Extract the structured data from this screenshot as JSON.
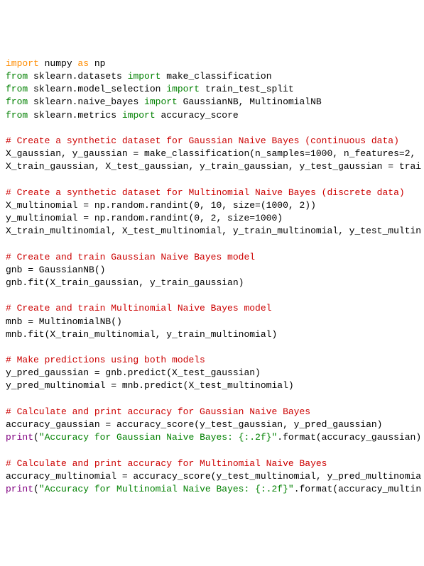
{
  "lines": [
    {
      "type": "code",
      "tokens": [
        {
          "cls": "kw-orange",
          "text": "import"
        },
        {
          "cls": "ident",
          "text": " numpy "
        },
        {
          "cls": "kw-orange",
          "text": "as"
        },
        {
          "cls": "ident",
          "text": " np"
        }
      ]
    },
    {
      "type": "code",
      "tokens": [
        {
          "cls": "kw-from",
          "text": "from"
        },
        {
          "cls": "ident",
          "text": " sklearn.datasets "
        },
        {
          "cls": "kw-from",
          "text": "import"
        },
        {
          "cls": "ident",
          "text": " make_classification"
        }
      ]
    },
    {
      "type": "code",
      "tokens": [
        {
          "cls": "kw-from",
          "text": "from"
        },
        {
          "cls": "ident",
          "text": " sklearn.model_selection "
        },
        {
          "cls": "kw-from",
          "text": "import"
        },
        {
          "cls": "ident",
          "text": " train_test_split"
        }
      ]
    },
    {
      "type": "code",
      "tokens": [
        {
          "cls": "kw-from",
          "text": "from"
        },
        {
          "cls": "ident",
          "text": " sklearn.naive_bayes "
        },
        {
          "cls": "kw-from",
          "text": "import"
        },
        {
          "cls": "ident",
          "text": " GaussianNB, MultinomialNB"
        }
      ]
    },
    {
      "type": "code",
      "tokens": [
        {
          "cls": "kw-from",
          "text": "from"
        },
        {
          "cls": "ident",
          "text": " sklearn.metrics "
        },
        {
          "cls": "kw-from",
          "text": "import"
        },
        {
          "cls": "ident",
          "text": " accuracy_score"
        }
      ]
    },
    {
      "type": "blank"
    },
    {
      "type": "comment",
      "text": "# Create a synthetic dataset for Gaussian Naive Bayes (continuous data)"
    },
    {
      "type": "code",
      "tokens": [
        {
          "cls": "ident",
          "text": "X_gaussian, y_gaussian = make_classification(n_samples=1000, n_features=2,"
        }
      ]
    },
    {
      "type": "code",
      "tokens": [
        {
          "cls": "ident",
          "text": "X_train_gaussian, X_test_gaussian, y_train_gaussian, y_test_gaussian = trai"
        }
      ]
    },
    {
      "type": "blank"
    },
    {
      "type": "comment",
      "text": "# Create a synthetic dataset for Multinomial Naive Bayes (discrete data)"
    },
    {
      "type": "code",
      "tokens": [
        {
          "cls": "ident",
          "text": "X_multinomial = np.random.randint(0, 10, size=(1000, 2))"
        }
      ]
    },
    {
      "type": "code",
      "tokens": [
        {
          "cls": "ident",
          "text": "y_multinomial = np.random.randint(0, 2, size=1000)"
        }
      ]
    },
    {
      "type": "code",
      "tokens": [
        {
          "cls": "ident",
          "text": "X_train_multinomial, X_test_multinomial, y_train_multinomial, y_test_multin"
        }
      ]
    },
    {
      "type": "blank"
    },
    {
      "type": "comment",
      "text": "# Create and train Gaussian Naive Bayes model"
    },
    {
      "type": "code",
      "tokens": [
        {
          "cls": "ident",
          "text": "gnb = GaussianNB()"
        }
      ]
    },
    {
      "type": "code",
      "tokens": [
        {
          "cls": "ident",
          "text": "gnb.fit(X_train_gaussian, y_train_gaussian)"
        }
      ]
    },
    {
      "type": "blank"
    },
    {
      "type": "comment",
      "text": "# Create and train Multinomial Naive Bayes model"
    },
    {
      "type": "code",
      "tokens": [
        {
          "cls": "ident",
          "text": "mnb = MultinomialNB()"
        }
      ]
    },
    {
      "type": "code",
      "tokens": [
        {
          "cls": "ident",
          "text": "mnb.fit(X_train_multinomial, y_train_multinomial)"
        }
      ]
    },
    {
      "type": "blank"
    },
    {
      "type": "comment",
      "text": "# Make predictions using both models"
    },
    {
      "type": "code",
      "tokens": [
        {
          "cls": "ident",
          "text": "y_pred_gaussian = gnb.predict(X_test_gaussian)"
        }
      ]
    },
    {
      "type": "code",
      "tokens": [
        {
          "cls": "ident",
          "text": "y_pred_multinomial = mnb.predict(X_test_multinomial)"
        }
      ]
    },
    {
      "type": "blank"
    },
    {
      "type": "comment",
      "text": "# Calculate and print accuracy for Gaussian Naive Bayes"
    },
    {
      "type": "code",
      "tokens": [
        {
          "cls": "ident",
          "text": "accuracy_gaussian = accuracy_score(y_test_gaussian, y_pred_gaussian)"
        }
      ]
    },
    {
      "type": "code",
      "tokens": [
        {
          "cls": "builtin",
          "text": "print"
        },
        {
          "cls": "ident",
          "text": "("
        },
        {
          "cls": "string",
          "text": "\"Accuracy for Gaussian Naive Bayes: {:.2f}\""
        },
        {
          "cls": "ident",
          "text": ".format(accuracy_gaussian)"
        }
      ]
    },
    {
      "type": "blank"
    },
    {
      "type": "comment",
      "text": "# Calculate and print accuracy for Multinomial Naive Bayes"
    },
    {
      "type": "code",
      "tokens": [
        {
          "cls": "ident",
          "text": "accuracy_multinomial = accuracy_score(y_test_multinomial, y_pred_multinomia"
        }
      ]
    },
    {
      "type": "code",
      "tokens": [
        {
          "cls": "builtin",
          "text": "print"
        },
        {
          "cls": "ident",
          "text": "("
        },
        {
          "cls": "string",
          "text": "\"Accuracy for Multinomial Naive Bayes: {:.2f}\""
        },
        {
          "cls": "ident",
          "text": ".format(accuracy_multin"
        }
      ]
    }
  ]
}
